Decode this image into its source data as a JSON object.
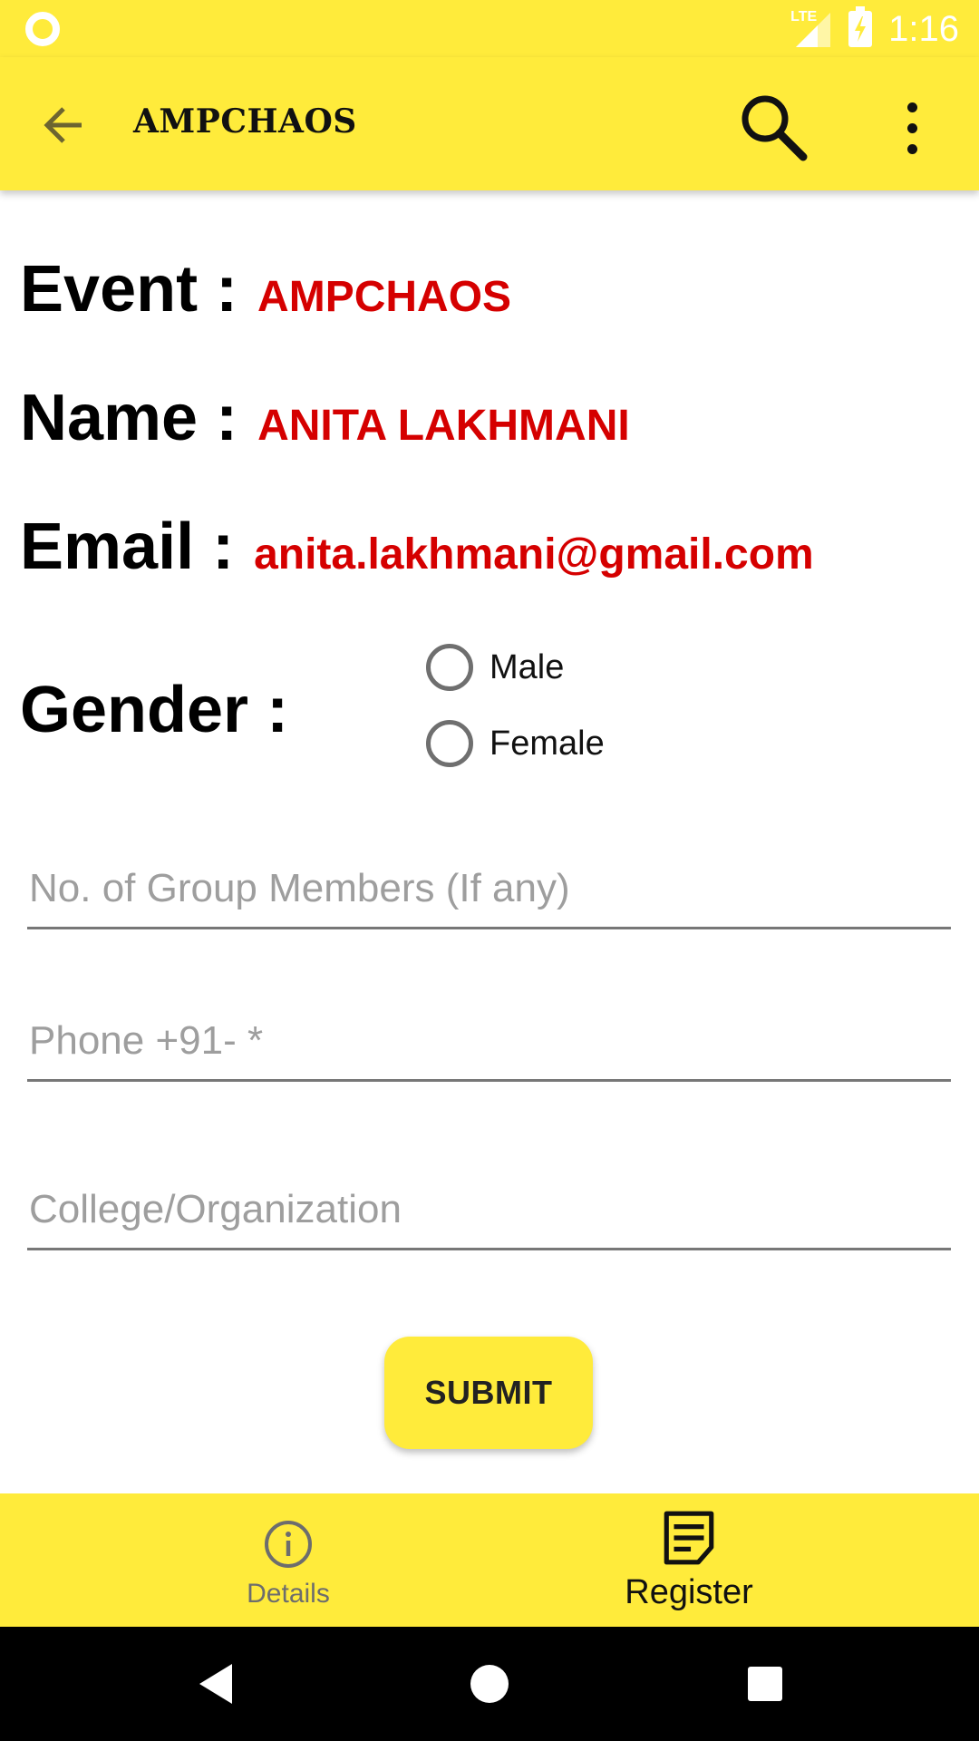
{
  "status_bar": {
    "time": "1:16",
    "network_label": "LTE"
  },
  "app_bar": {
    "title": "AMPCHAOS"
  },
  "form": {
    "event": {
      "label": "Event :",
      "value": "AMPCHAOS"
    },
    "name": {
      "label": "Name :",
      "value": "ANITA LAKHMANI"
    },
    "email": {
      "label": "Email :",
      "value": "anita.lakhmani@gmail.com"
    },
    "gender": {
      "label": "Gender  :",
      "options": [
        "Male",
        "Female"
      ]
    },
    "group_members": {
      "placeholder": "No. of Group Members (If any)",
      "value": ""
    },
    "phone": {
      "placeholder": "Phone +91- *",
      "value": ""
    },
    "college": {
      "placeholder": "College/Organization",
      "value": ""
    },
    "submit_label": "SUBMIT"
  },
  "bottom_nav": {
    "items": [
      {
        "label": "Details",
        "icon": "info-icon",
        "selected": false
      },
      {
        "label": "Register",
        "icon": "note-icon",
        "selected": true
      }
    ]
  },
  "colors": {
    "accent": "#ffeb3b",
    "value_red": "#d50000"
  }
}
